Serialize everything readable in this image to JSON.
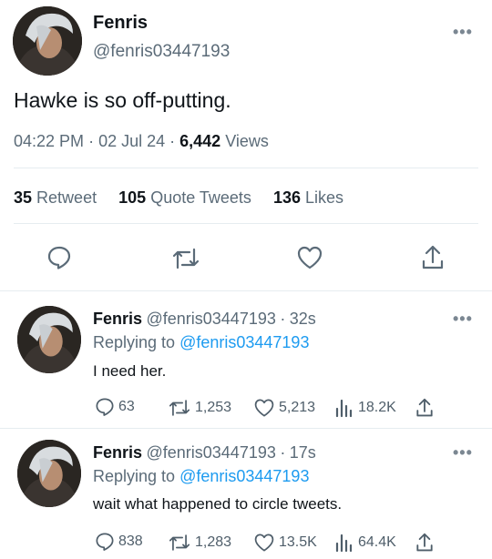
{
  "main_tweet": {
    "display_name": "Fenris",
    "handle": "@fenris03447193",
    "text": "Hawke is so off-putting.",
    "time": "04:22 PM",
    "date": "02 Jul 24",
    "views_count": "6,442",
    "views_label": "Views",
    "retweets_count": "35",
    "retweets_label": "Retweet",
    "quotes_count": "105",
    "quotes_label": "Quote Tweets",
    "likes_count": "136",
    "likes_label": "Likes",
    "more_icon": "more-horizontal-icon",
    "actions": [
      "reply-icon",
      "retweet-icon",
      "like-icon",
      "share-icon"
    ]
  },
  "replies": [
    {
      "display_name": "Fenris",
      "handle": "@fenris03447193",
      "time": "32s",
      "replying_label": "Replying to",
      "replying_to": "@fenris03447193",
      "text": "I need her.",
      "replies": "63",
      "retweets": "1,253",
      "likes": "5,213",
      "views": "18.2K"
    },
    {
      "display_name": "Fenris",
      "handle": "@fenris03447193",
      "time": "17s",
      "replying_label": "Replying to",
      "replying_to": "@fenris03447193",
      "text": "wait what happened to circle tweets.",
      "replies": "838",
      "retweets": "1,283",
      "likes": "13.5K",
      "views": "64.4K"
    }
  ],
  "colors": {
    "accent": "#1d9bf0",
    "secondary_text": "#5b6b78",
    "divider": "#e6ecf0"
  }
}
